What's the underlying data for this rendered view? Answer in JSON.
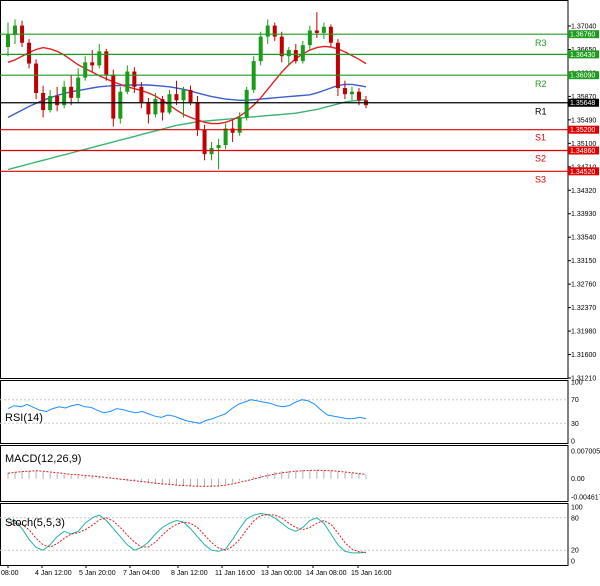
{
  "chart_data": [
    {
      "type": "candlestick",
      "panel": "price",
      "y_ticks": [
        "1.37040",
        "1.36650",
        "1.36262",
        "1.35870",
        "1.35490",
        "1.35100",
        "1.34710",
        "1.34320",
        "1.33930",
        "1.33540",
        "1.33150",
        "1.32760",
        "1.32370",
        "1.31980",
        "1.31600",
        "1.31210"
      ],
      "ylim": [
        1.3121,
        1.3722
      ],
      "levels": [
        {
          "name": "R3",
          "value": 1.3676,
          "label": "1.36760",
          "color": "#1e9c1e"
        },
        {
          "name": "",
          "value": 1.3643,
          "label": "1.36430",
          "color": "#1e9c1e"
        },
        {
          "name": "R2",
          "value": 1.3609,
          "label": "1.36090",
          "color": "#1e9c1e"
        },
        {
          "name": "R1",
          "value": 1.3564,
          "label": "1.35648",
          "color": "#000000"
        },
        {
          "name": "S1",
          "value": 1.352,
          "label": "1.35200",
          "color": "#e00000"
        },
        {
          "name": "S2",
          "value": 1.3486,
          "label": "1.34860",
          "color": "#e00000"
        },
        {
          "name": "S3",
          "value": 1.3452,
          "label": "1.34520",
          "color": "#e00000"
        }
      ],
      "current_price": "1.35648",
      "x_ticks": [
        "08:00",
        "4 Jan 12:00",
        "5 Jan 20:00",
        "7 Jan 04:00",
        "8 Jan 12:00",
        "11 Jan 16:00",
        "13 Jan 00:00",
        "14 Jan 08:00",
        "15 Jan 16:00"
      ],
      "candles": [
        {
          "o": 1.3655,
          "h": 1.3695,
          "l": 1.364,
          "c": 1.3675
        },
        {
          "o": 1.3675,
          "h": 1.37,
          "l": 1.366,
          "c": 1.369
        },
        {
          "o": 1.369,
          "h": 1.3698,
          "l": 1.3655,
          "c": 1.3662
        },
        {
          "o": 1.3662,
          "h": 1.3668,
          "l": 1.362,
          "c": 1.3628
        },
        {
          "o": 1.3628,
          "h": 1.3635,
          "l": 1.357,
          "c": 1.358
        },
        {
          "o": 1.358,
          "h": 1.3592,
          "l": 1.354,
          "c": 1.3552
        },
        {
          "o": 1.3552,
          "h": 1.3585,
          "l": 1.3548,
          "c": 1.3575
        },
        {
          "o": 1.3575,
          "h": 1.359,
          "l": 1.355,
          "c": 1.356
        },
        {
          "o": 1.356,
          "h": 1.36,
          "l": 1.3555,
          "c": 1.359
        },
        {
          "o": 1.359,
          "h": 1.361,
          "l": 1.356,
          "c": 1.3572
        },
        {
          "o": 1.3572,
          "h": 1.362,
          "l": 1.3565,
          "c": 1.3605
        },
        {
          "o": 1.3605,
          "h": 1.364,
          "l": 1.36,
          "c": 1.363
        },
        {
          "o": 1.363,
          "h": 1.365,
          "l": 1.3615,
          "c": 1.3625
        },
        {
          "o": 1.3625,
          "h": 1.366,
          "l": 1.362,
          "c": 1.3648
        },
        {
          "o": 1.3648,
          "h": 1.3652,
          "l": 1.36,
          "c": 1.361
        },
        {
          "o": 1.361,
          "h": 1.3618,
          "l": 1.3525,
          "c": 1.3538
        },
        {
          "o": 1.3538,
          "h": 1.359,
          "l": 1.353,
          "c": 1.3582
        },
        {
          "o": 1.3582,
          "h": 1.3625,
          "l": 1.3578,
          "c": 1.3615
        },
        {
          "o": 1.3615,
          "h": 1.3622,
          "l": 1.358,
          "c": 1.359
        },
        {
          "o": 1.359,
          "h": 1.3598,
          "l": 1.3555,
          "c": 1.3565
        },
        {
          "o": 1.3565,
          "h": 1.3572,
          "l": 1.353,
          "c": 1.3545
        },
        {
          "o": 1.3545,
          "h": 1.358,
          "l": 1.354,
          "c": 1.357
        },
        {
          "o": 1.357,
          "h": 1.3575,
          "l": 1.3535,
          "c": 1.3548
        },
        {
          "o": 1.3548,
          "h": 1.3585,
          "l": 1.3545,
          "c": 1.3578
        },
        {
          "o": 1.3578,
          "h": 1.36,
          "l": 1.356,
          "c": 1.3568
        },
        {
          "o": 1.3568,
          "h": 1.359,
          "l": 1.354,
          "c": 1.3585
        },
        {
          "o": 1.3585,
          "h": 1.3592,
          "l": 1.356,
          "c": 1.3565
        },
        {
          "o": 1.3565,
          "h": 1.3575,
          "l": 1.351,
          "c": 1.352
        },
        {
          "o": 1.352,
          "h": 1.3528,
          "l": 1.347,
          "c": 1.348
        },
        {
          "o": 1.348,
          "h": 1.35,
          "l": 1.347,
          "c": 1.349
        },
        {
          "o": 1.349,
          "h": 1.3505,
          "l": 1.3455,
          "c": 1.3495
        },
        {
          "o": 1.3495,
          "h": 1.353,
          "l": 1.3488,
          "c": 1.3522
        },
        {
          "o": 1.3522,
          "h": 1.3535,
          "l": 1.35,
          "c": 1.3515
        },
        {
          "o": 1.3515,
          "h": 1.3548,
          "l": 1.351,
          "c": 1.354
        },
        {
          "o": 1.354,
          "h": 1.359,
          "l": 1.3535,
          "c": 1.3585
        },
        {
          "o": 1.3585,
          "h": 1.364,
          "l": 1.358,
          "c": 1.3632
        },
        {
          "o": 1.3632,
          "h": 1.368,
          "l": 1.3625,
          "c": 1.3672
        },
        {
          "o": 1.3672,
          "h": 1.37,
          "l": 1.366,
          "c": 1.369
        },
        {
          "o": 1.369,
          "h": 1.3695,
          "l": 1.3665,
          "c": 1.3672
        },
        {
          "o": 1.3672,
          "h": 1.368,
          "l": 1.363,
          "c": 1.364
        },
        {
          "o": 1.364,
          "h": 1.3655,
          "l": 1.3625,
          "c": 1.365
        },
        {
          "o": 1.365,
          "h": 1.366,
          "l": 1.3628,
          "c": 1.3632
        },
        {
          "o": 1.3632,
          "h": 1.3665,
          "l": 1.3628,
          "c": 1.3658
        },
        {
          "o": 1.3658,
          "h": 1.369,
          "l": 1.365,
          "c": 1.3682
        },
        {
          "o": 1.3682,
          "h": 1.3712,
          "l": 1.367,
          "c": 1.3678
        },
        {
          "o": 1.3678,
          "h": 1.3695,
          "l": 1.3668,
          "c": 1.3688
        },
        {
          "o": 1.3688,
          "h": 1.3692,
          "l": 1.3655,
          "c": 1.3662
        },
        {
          "o": 1.3662,
          "h": 1.3668,
          "l": 1.3575,
          "c": 1.3588
        },
        {
          "o": 1.3588,
          "h": 1.36,
          "l": 1.357,
          "c": 1.3578
        },
        {
          "o": 1.3578,
          "h": 1.359,
          "l": 1.3568,
          "c": 1.3582
        },
        {
          "o": 1.3582,
          "h": 1.3588,
          "l": 1.356,
          "c": 1.3568
        },
        {
          "o": 1.3568,
          "h": 1.3575,
          "l": 1.3555,
          "c": 1.356
        }
      ],
      "ma_fast": [
        1.363,
        1.3634,
        1.364,
        1.3646,
        1.3651,
        1.3654,
        1.3652,
        1.3648,
        1.3642,
        1.3634,
        1.3626,
        1.362,
        1.3614,
        1.3608,
        1.3603,
        1.3598,
        1.3594,
        1.359,
        1.3587,
        1.3584,
        1.358,
        1.3575,
        1.3568,
        1.356,
        1.3552,
        1.3545,
        1.354,
        1.3536,
        1.3532,
        1.353,
        1.353,
        1.3532,
        1.3536,
        1.3542,
        1.355,
        1.356,
        1.3572,
        1.3586,
        1.36,
        1.3614,
        1.3626,
        1.3636,
        1.3644,
        1.365,
        1.3654,
        1.3656,
        1.3655,
        1.3652,
        1.3647,
        1.3641,
        1.3635,
        1.3628
      ],
      "ma_mid": [
        1.354,
        1.3546,
        1.3552,
        1.3558,
        1.3563,
        1.3568,
        1.3572,
        1.3576,
        1.3579,
        1.3582,
        1.3584,
        1.3586,
        1.3588,
        1.359,
        1.3591,
        1.3592,
        1.3592,
        1.3593,
        1.3593,
        1.3593,
        1.3593,
        1.3592,
        1.3591,
        1.359,
        1.3588,
        1.3586,
        1.3583,
        1.358,
        1.3577,
        1.3574,
        1.3572,
        1.357,
        1.3569,
        1.3568,
        1.3568,
        1.3569,
        1.357,
        1.3571,
        1.3572,
        1.3573,
        1.3574,
        1.3575,
        1.3576,
        1.3577,
        1.358,
        1.3584,
        1.3588,
        1.3592,
        1.3594,
        1.3594,
        1.3592,
        1.359
      ],
      "ma_slow": [
        1.3455,
        1.3458,
        1.3461,
        1.3464,
        1.3467,
        1.347,
        1.3473,
        1.3476,
        1.3479,
        1.3482,
        1.3485,
        1.3488,
        1.3491,
        1.3494,
        1.3497,
        1.35,
        1.3503,
        1.3506,
        1.3509,
        1.3512,
        1.3515,
        1.3518,
        1.3521,
        1.3524,
        1.3527,
        1.3529,
        1.3531,
        1.3533,
        1.3534,
        1.3535,
        1.3536,
        1.3537,
        1.3538,
        1.3539,
        1.354,
        1.3541,
        1.3542,
        1.3543,
        1.3544,
        1.3545,
        1.3546,
        1.3547,
        1.3549,
        1.3551,
        1.3553,
        1.3556,
        1.3559,
        1.3562,
        1.3565,
        1.3567,
        1.3568,
        1.3569
      ]
    },
    {
      "type": "line",
      "panel": "rsi",
      "title": "RSI(14)",
      "y_ticks": [
        "100",
        "70",
        "30",
        "0"
      ],
      "ylim": [
        0,
        100
      ],
      "values": [
        55,
        60,
        58,
        62,
        57,
        52,
        50,
        55,
        58,
        56,
        60,
        62,
        58,
        57,
        52,
        48,
        50,
        55,
        53,
        50,
        48,
        50,
        46,
        42,
        40,
        44,
        42,
        38,
        34,
        32,
        30,
        35,
        38,
        42,
        46,
        55,
        62,
        66,
        70,
        68,
        66,
        64,
        60,
        58,
        60,
        66,
        70,
        68,
        62,
        52,
        44,
        42,
        40,
        38,
        38,
        40,
        38
      ]
    },
    {
      "type": "bar+line",
      "panel": "macd",
      "title": "MACD(12,26,9)",
      "y_ticks": [
        "0.007005",
        "0.00",
        "-0.004617"
      ],
      "ylim": [
        -0.004617,
        0.007005
      ],
      "histogram": [
        0.0015,
        0.0018,
        0.002,
        0.0021,
        0.002,
        0.0017,
        0.0014,
        0.0012,
        0.001,
        0.0009,
        0.0008,
        0.0007,
        0.0006,
        0.0004,
        0.0002,
        0.0,
        -0.0003,
        -0.0005,
        -0.0007,
        -0.0009,
        -0.0011,
        -0.0013,
        -0.0015,
        -0.0016,
        -0.0017,
        -0.0018,
        -0.0019,
        -0.002,
        -0.002,
        -0.0019,
        -0.0017,
        -0.0014,
        -0.001,
        -0.0005,
        0.0,
        0.0005,
        0.001,
        0.0014,
        0.0017,
        0.0019,
        0.002,
        0.0021,
        0.0022,
        0.0022,
        0.0022,
        0.0021,
        0.002,
        0.0018,
        0.0016,
        0.0014,
        0.0012,
        0.001
      ],
      "signal": [
        0.0014,
        0.0016,
        0.0018,
        0.0019,
        0.002,
        0.0019,
        0.0017,
        0.0015,
        0.0013,
        0.0011,
        0.001,
        0.0008,
        0.0007,
        0.0005,
        0.0003,
        0.0001,
        -0.0001,
        -0.0003,
        -0.0005,
        -0.0007,
        -0.0009,
        -0.0011,
        -0.0013,
        -0.0014,
        -0.0016,
        -0.0017,
        -0.0018,
        -0.0019,
        -0.0019,
        -0.0019,
        -0.0018,
        -0.0016,
        -0.0013,
        -0.0009,
        -0.0005,
        -0.0001,
        0.0004,
        0.0008,
        0.0012,
        0.0015,
        0.0017,
        0.0019,
        0.002,
        0.0021,
        0.0021,
        0.0021,
        0.002,
        0.0019,
        0.0017,
        0.0015,
        0.0013,
        0.0011
      ]
    },
    {
      "type": "line",
      "panel": "stoch",
      "title": "Stoch(5,5,3)",
      "y_ticks": [
        "100",
        "80",
        "20",
        "0"
      ],
      "ylim": [
        0,
        100
      ],
      "k": [
        70,
        75,
        60,
        40,
        25,
        20,
        30,
        45,
        55,
        50,
        55,
        70,
        80,
        85,
        75,
        60,
        45,
        30,
        20,
        25,
        35,
        50,
        62,
        70,
        75,
        72,
        60,
        45,
        30,
        20,
        18,
        22,
        40,
        60,
        78,
        85,
        88,
        86,
        80,
        70,
        60,
        55,
        62,
        75,
        80,
        70,
        50,
        30,
        18,
        15,
        15,
        16
      ],
      "d": [
        65,
        70,
        68,
        58,
        42,
        30,
        26,
        32,
        42,
        50,
        52,
        58,
        66,
        76,
        80,
        74,
        62,
        48,
        35,
        26,
        26,
        35,
        48,
        60,
        68,
        72,
        70,
        62,
        48,
        34,
        24,
        20,
        27,
        40,
        58,
        74,
        84,
        86,
        85,
        80,
        70,
        62,
        58,
        62,
        70,
        75,
        68,
        52,
        34,
        22,
        17,
        16
      ]
    }
  ]
}
